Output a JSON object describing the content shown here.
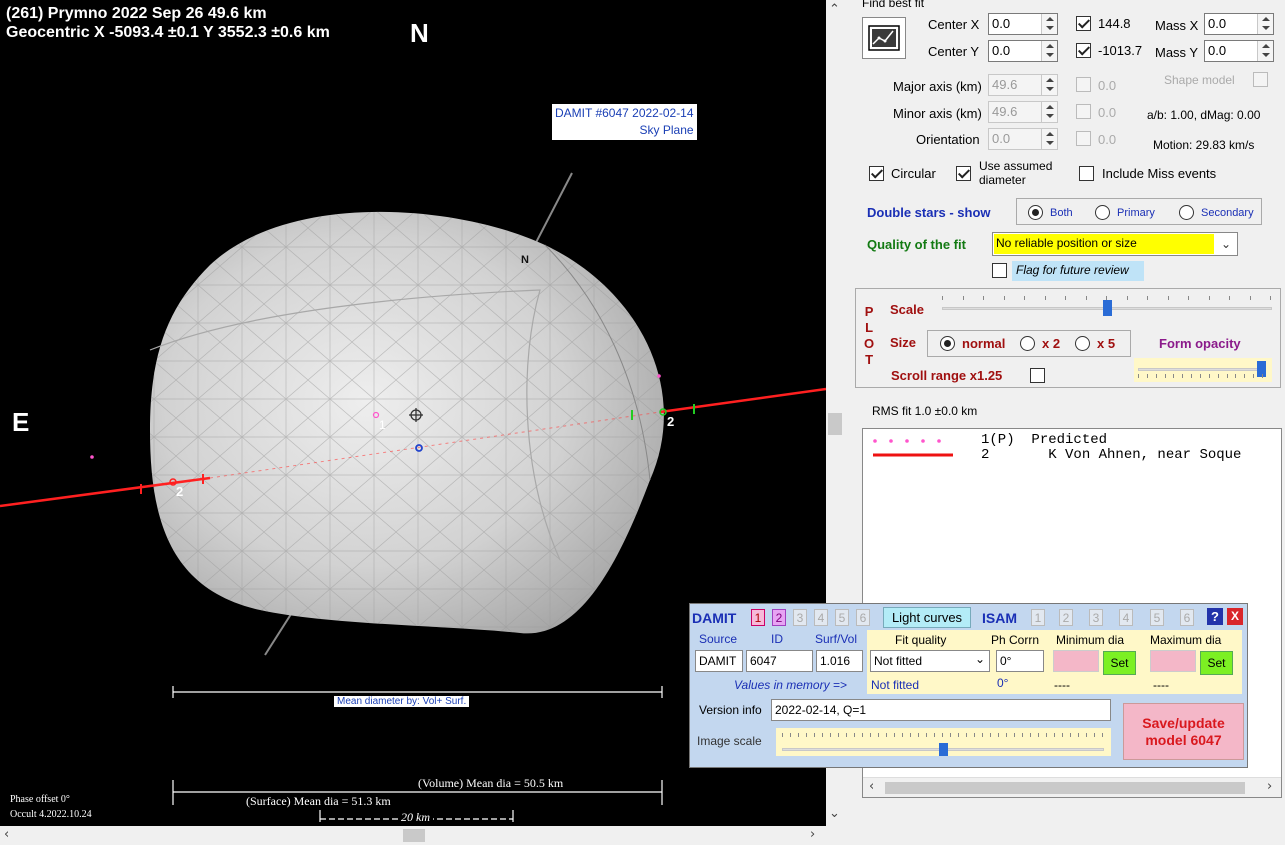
{
  "plot": {
    "title_line1": "(261) Prymno  2022 Sep 26   49.6 km",
    "title_line2": "Geocentric  X  -5093.4 ±0.1  Y 3552.3 ±0.6 km",
    "north": "N",
    "east": "E",
    "model_label_line1": "DAMIT #6047 2022-02-14",
    "model_label_line2": "Sky Plane",
    "pole_label": "N",
    "chord_label": "2",
    "chord_label_right": "2",
    "predicted_marker": "1",
    "mean_diameter_by": "Mean diameter by: Vol+ Surf.",
    "volume_mean_dia": "(Volume) Mean dia = 50.5 km",
    "surface_mean_dia": "(Surface) Mean dia = 51.3 km",
    "scale_bar": "20 km",
    "phase_offset": "Phase offset 0°",
    "version": "Occult 4.2022.10.24"
  },
  "fit": {
    "find_best_fit": "Find best fit",
    "center_x_label": "Center X",
    "center_x": "0.0",
    "center_y_label": "Center Y",
    "center_y": "0.0",
    "x_value": "144.8",
    "y_value": "-1013.7",
    "mass_x_label": "Mass X",
    "mass_x": "0.0",
    "mass_y_label": "Mass Y",
    "mass_y": "0.0",
    "major_label": "Major axis (km)",
    "major": "49.6",
    "minor_label": "Minor axis (km)",
    "minor": "49.6",
    "orient_label": "Orientation",
    "orient": "0.0",
    "dis_val1": "0.0",
    "dis_val2": "0.0",
    "dis_val3": "0.0",
    "shape_model": "Shape model",
    "ab_dmag": "a/b: 1.00, dMag: 0.00",
    "motion": "Motion: 29.83 km/s",
    "circular": "Circular",
    "use_assumed_line1": "Use assumed",
    "use_assumed_line2": "diameter",
    "include_miss": "Include Miss events",
    "double_stars": "Double stars - show",
    "ds_both": "Both",
    "ds_primary": "Primary",
    "ds_secondary": "Secondary",
    "quality_label": "Quality of the fit",
    "quality_value": "No reliable position or size",
    "flag_review": "Flag for future review"
  },
  "plotbox": {
    "plot_word_p": "P",
    "plot_word_l": "L",
    "plot_word_o": "O",
    "plot_word_t": "T",
    "scale": "Scale",
    "scale_level": 0.5,
    "size": "Size",
    "normal": "normal",
    "x2": "x 2",
    "x5": "x 5",
    "form_opacity": "Form opacity",
    "opacity_level": 1.0,
    "scroll_range": "Scroll range x1.25"
  },
  "rms": "RMS fit 1.0 ±0.0 km",
  "legend": [
    {
      "id": "1(P)",
      "desc": "Predicted"
    },
    {
      "id": "2",
      "desc": "K Von Ahnen, near Soque"
    }
  ],
  "damit": {
    "damit": "DAMIT",
    "d1": "1",
    "d2": "2",
    "d3": "3",
    "d4": "4",
    "d5": "5",
    "d6": "6",
    "light_curves": "Light curves",
    "isam": "ISAM",
    "i1": "1",
    "i2": "2",
    "i3": "3",
    "i4": "4",
    "i5": "5",
    "i6": "6",
    "help": "?",
    "close": "X",
    "source_label": "Source",
    "id_label": "ID",
    "surfvol_label": "Surf/Vol",
    "source": "DAMIT",
    "id": "6047",
    "surfvol": "1.016",
    "fit_quality_label": "Fit quality",
    "fit_quality": "Not fitted",
    "fit_quality_mem": "Not fitted",
    "phcorr_label": "Ph Corrn",
    "phcorr": "0°",
    "phcorr_mem": "0°",
    "min_dia_label": "Minimum dia",
    "max_dia_label": "Maximum dia",
    "set": "Set",
    "min_mem": "----",
    "max_mem": "----",
    "values_in_memory": "Values in memory =>",
    "version_label": "Version info",
    "version": "2022-02-14, Q=1",
    "image_scale_label": "Image scale",
    "image_scale_level": 0.5,
    "save_line1": "Save/update",
    "save_line2": "model 6047"
  }
}
